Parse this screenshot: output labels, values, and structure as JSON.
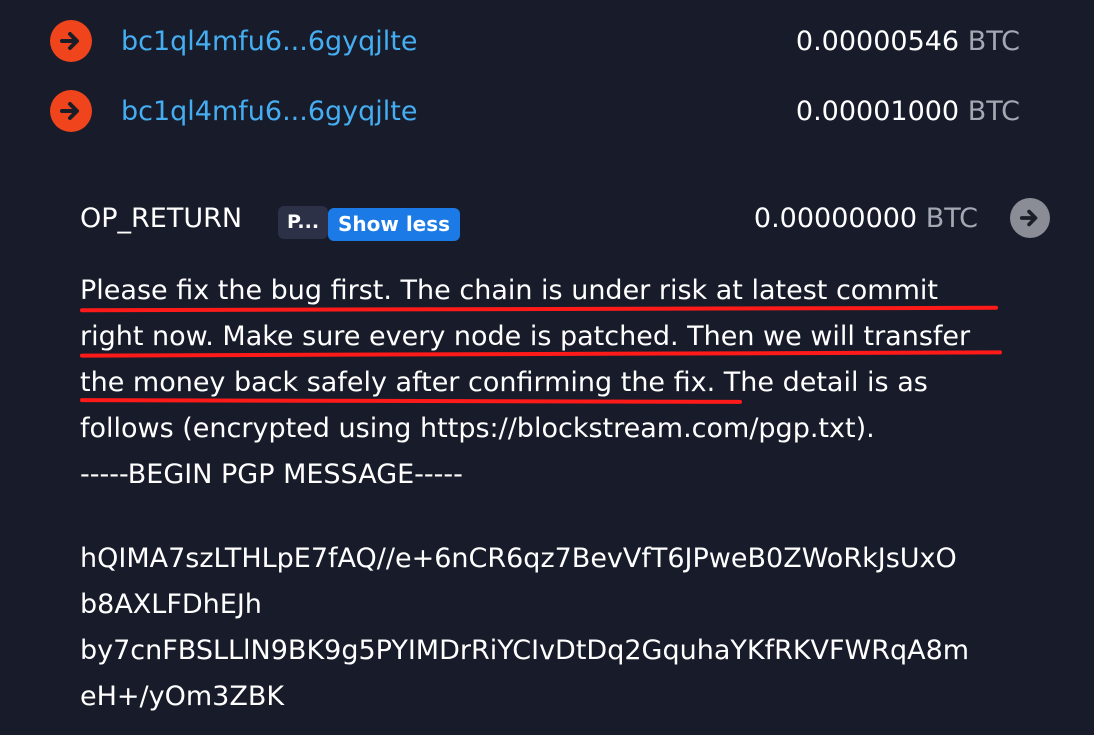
{
  "outputs": [
    {
      "address": "bc1ql4mfu6...6gyqjlte",
      "amount": "0.00000546",
      "unit": "BTC",
      "icon": "arrow-right-icon"
    },
    {
      "address": "bc1ql4mfu6...6gyqjlte",
      "amount": "0.00001000",
      "unit": "BTC",
      "icon": "arrow-right-icon"
    }
  ],
  "op_return": {
    "label": "OP_RETURN",
    "badge": "P...",
    "show_less": "Show less",
    "amount": "0.00000000",
    "unit": "BTC",
    "icon": "arrow-right-icon"
  },
  "message": {
    "lines": [
      "Please fix the bug first. The chain is under risk at latest commit",
      "right now. Make sure every node is patched. Then we will transfer",
      "the money back safely after confirming the fix. The detail is as",
      "follows (encrypted using https://blockstream.com/pgp.txt).",
      "-----BEGIN PGP MESSAGE-----"
    ],
    "pgp_lines": [
      "hQIMA7szLTHLpE7fAQ//e+6nCR6qz7BevVfT6JPweB0ZWoRkJsUxO",
      "b8AXLFDhEJh",
      "by7cnFBSLLlN9BK9g5PYIMDrRiYCIvDtDq2GquhaYKfRKVFWRqA8m",
      "eH+/yOm3ZBK"
    ]
  },
  "colors": {
    "background": "#181c2a",
    "link": "#45aef2",
    "output_icon": "#f0451c",
    "show_less": "#1b7ae6",
    "underline": "#ff1a1a"
  }
}
